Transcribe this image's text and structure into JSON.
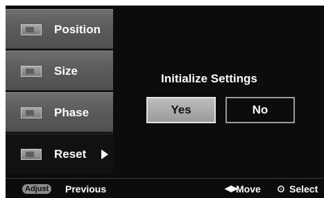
{
  "sidebar": {
    "items": [
      {
        "label": "Position",
        "icon": "position-icon"
      },
      {
        "label": "Size",
        "icon": "size-icon"
      },
      {
        "label": "Phase",
        "icon": "phase-icon"
      },
      {
        "label": "Reset",
        "icon": "reset-icon",
        "selected": true
      }
    ]
  },
  "dialog": {
    "title": "Initialize Settings",
    "yes_label": "Yes",
    "no_label": "No"
  },
  "footer": {
    "adjust_key": "Adjust",
    "previous_label": "Previous",
    "move_icon": "◀▶",
    "move_label": "Move",
    "select_label": "Select"
  },
  "colors": {
    "background": "#0c0c0c",
    "menu_item": "#5c5c5c",
    "button_highlight": "#b0b0b0",
    "text": "#ffffff"
  }
}
